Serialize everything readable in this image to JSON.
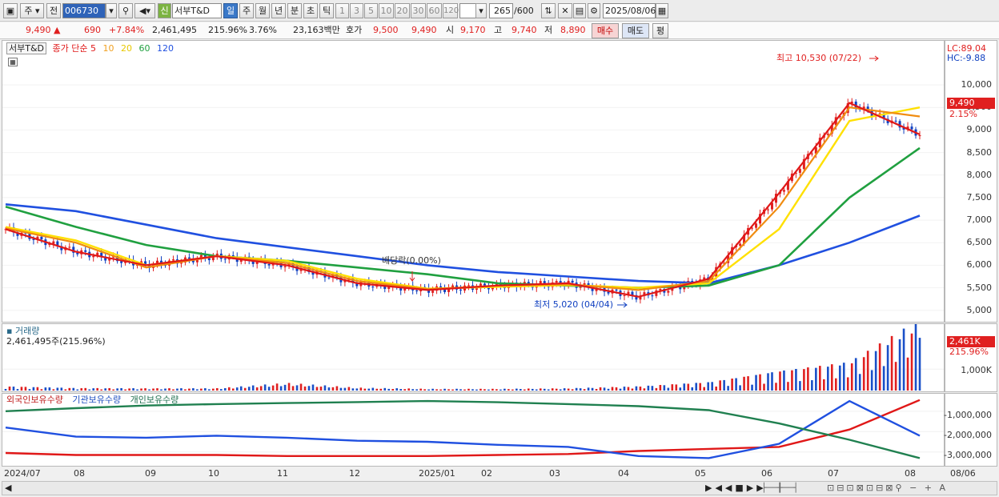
{
  "toolbar": {
    "market_btn": "주",
    "prev_btn": "전",
    "code": "006730",
    "search_icon": "search-icon",
    "shin_btn": "신",
    "stock_name": "서부T&D",
    "periods": [
      "일",
      "주",
      "월",
      "년",
      "분",
      "초",
      "틱"
    ],
    "minutes": [
      "1",
      "3",
      "5",
      "10",
      "20",
      "30",
      "60",
      "120"
    ],
    "count": "265",
    "total": "/600",
    "date": "2025/08/06"
  },
  "quote": {
    "price": "9,490",
    "arrow": "▲",
    "change": "690",
    "change_pct": "+7.84%",
    "volume": "2,461,495",
    "vol_ratio": "215.96%",
    "turnover": "3.76%",
    "amount": "23,163백만",
    "hoga_label": "호가",
    "hoga1": "9,500",
    "hoga2": "9,490",
    "open_label": "시",
    "open": "9,170",
    "high_label": "고",
    "high": "9,740",
    "low_label": "저",
    "low": "8,890",
    "buy_btn": "매수",
    "sell_btn": "매도",
    "eval_btn": "평"
  },
  "price_panel": {
    "legend_name": "서부T&D",
    "legend_ma": "종가 단순",
    "ma_periods": [
      "5",
      "10",
      "20",
      "60",
      "120"
    ],
    "lc": "LC:89.04",
    "hc": "HC:-9.88",
    "last_price": "9,490",
    "last_pct": "2.15%",
    "high_note": "최고 10,530 (07/22)",
    "low_note": "최저 5,020 (04/04)",
    "event_note": "배당락(0.00%)"
  },
  "volume_panel": {
    "title": "거래량",
    "value": "2,461,495주(215.96%)",
    "last_vol": "2,461K",
    "last_pct": "215.96%",
    "ticks": [
      "1,000K"
    ]
  },
  "holdings_panel": {
    "legend": [
      "외국인보유수량",
      "기관보유수량",
      "개인보유수량"
    ],
    "ticks": [
      "-1,000,000",
      "-2,000,000",
      "-3,000,000"
    ]
  },
  "x_ticks": [
    "2024/07",
    "08",
    "09",
    "10",
    "11",
    "12",
    "2025/01",
    "02",
    "03",
    "04",
    "05",
    "06",
    "07",
    "08",
    "08/06"
  ],
  "chart_data": [
    {
      "type": "line",
      "title": "서부T&D",
      "ylim": [
        4800,
        10800
      ],
      "yticks": [
        5000,
        5500,
        6000,
        6500,
        7000,
        7500,
        8000,
        8500,
        9000,
        9500,
        10000
      ],
      "x": [
        "2024/07",
        "08",
        "09",
        "10",
        "11",
        "12",
        "2025/01",
        "02",
        "03",
        "04",
        "05",
        "06",
        "07",
        "08"
      ],
      "series": [
        {
          "name": "5",
          "color": "#e01818",
          "values": [
            6800,
            6300,
            6000,
            6200,
            6000,
            5600,
            5450,
            5550,
            5600,
            5300,
            5700,
            7600,
            9600,
            8900
          ]
        },
        {
          "name": "10",
          "color": "#f08c10",
          "values": [
            6820,
            6500,
            5950,
            6200,
            6050,
            5650,
            5470,
            5550,
            5580,
            5450,
            5650,
            7300,
            9500,
            9300
          ]
        },
        {
          "name": "20",
          "color": "#ffe000",
          "values": [
            6850,
            6550,
            6000,
            6200,
            6100,
            5700,
            5480,
            5520,
            5560,
            5500,
            5600,
            6800,
            9200,
            9500
          ]
        },
        {
          "name": "60",
          "color": "#20a040",
          "values": [
            7300,
            6850,
            6450,
            6200,
            6100,
            5950,
            5800,
            5600,
            5550,
            5500,
            5550,
            6000,
            7500,
            8600
          ]
        },
        {
          "name": "120",
          "color": "#2050e0",
          "values": [
            7350,
            7200,
            6900,
            6600,
            6400,
            6200,
            6000,
            5850,
            5750,
            5650,
            5600,
            6000,
            6500,
            7100
          ]
        }
      ],
      "annotations": [
        "최고 10,530 (07/22)",
        "최저 5,020 (04/04)",
        "배당락(0.00%)"
      ]
    },
    {
      "type": "bar",
      "title": "거래량",
      "ylim": [
        0,
        2800000
      ],
      "yticks": [
        1000000
      ],
      "categories": [
        "2024/07",
        "08",
        "09",
        "10",
        "11",
        "12",
        "2025/01",
        "02",
        "03",
        "04",
        "05",
        "06",
        "07",
        "08"
      ],
      "values": [
        150000,
        90000,
        80000,
        80000,
        260000,
        100000,
        60000,
        60000,
        80000,
        150000,
        300000,
        700000,
        1000000,
        2461495
      ]
    },
    {
      "type": "line",
      "title": "보유수량",
      "ylim": [
        -3600000,
        -300000
      ],
      "yticks": [
        -1000000,
        -2000000,
        -3000000
      ],
      "x": [
        "2024/07",
        "08",
        "09",
        "10",
        "11",
        "12",
        "2025/01",
        "02",
        "03",
        "04",
        "05",
        "06",
        "07",
        "08"
      ],
      "series": [
        {
          "name": "외국인보유수량",
          "color": "#e01818",
          "values": [
            -3050000,
            -3150000,
            -3150000,
            -3150000,
            -3200000,
            -3200000,
            -3200000,
            -3150000,
            -3100000,
            -2950000,
            -2850000,
            -2750000,
            -1900000,
            -450000
          ]
        },
        {
          "name": "기관보유수량",
          "color": "#2050e0",
          "values": [
            -1800000,
            -2250000,
            -2300000,
            -2200000,
            -2300000,
            -2450000,
            -2500000,
            -2650000,
            -2750000,
            -3200000,
            -3300000,
            -2600000,
            -500000,
            -2200000
          ]
        },
        {
          "name": "개인보유수량",
          "color": "#208050",
          "values": [
            -1000000,
            -850000,
            -720000,
            -650000,
            -600000,
            -550000,
            -500000,
            -560000,
            -650000,
            -750000,
            -950000,
            -1600000,
            -2400000,
            -3300000
          ]
        }
      ]
    }
  ]
}
